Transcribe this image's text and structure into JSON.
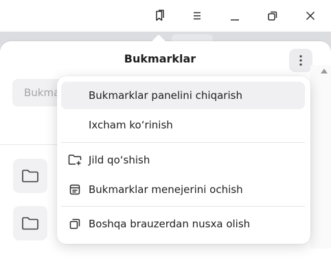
{
  "window": {
    "controls": [
      {
        "name": "bookmarks-icon"
      },
      {
        "name": "menu-icon"
      },
      {
        "name": "minimize-icon"
      },
      {
        "name": "restore-icon"
      },
      {
        "name": "close-icon"
      }
    ]
  },
  "bookmarks_panel": {
    "title": "Bukmarklar",
    "search_placeholder": "Bukmarklar"
  },
  "context_menu": {
    "items": [
      {
        "label": "Bukmarklar panelini chiqarish",
        "icon": ""
      },
      {
        "label": "Ixcham ko‘rinish",
        "icon": ""
      },
      {
        "label": "Jild qo‘shish",
        "icon": "add-folder-icon"
      },
      {
        "label": "Bukmarklar menejerini ochish",
        "icon": "bookmark-manager-icon"
      },
      {
        "label": "Boshqa brauzerdan nusxa olish",
        "icon": "copy-icon"
      }
    ]
  },
  "colors": {
    "accent_hover": "#f0f0f2",
    "text": "#1e1e1e",
    "placeholder": "#a4a4a8"
  }
}
